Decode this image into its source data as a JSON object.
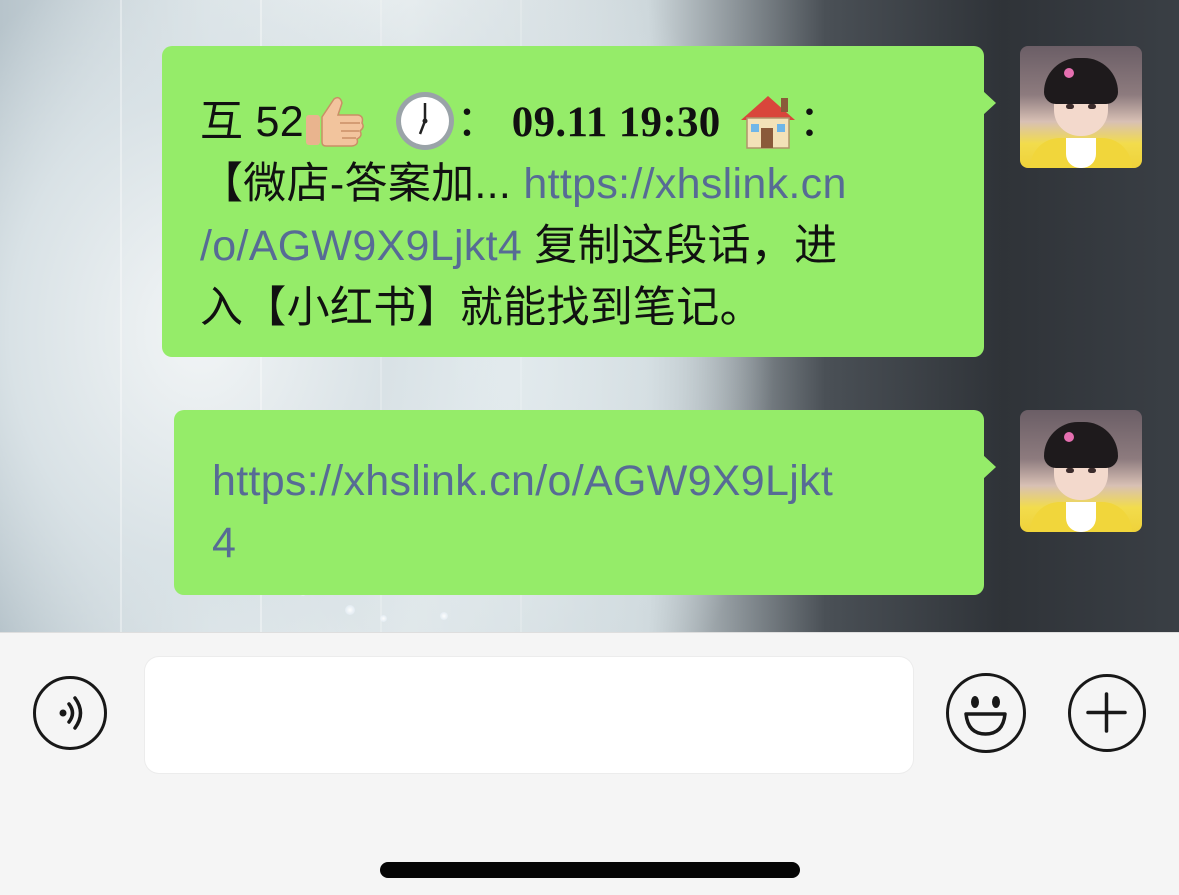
{
  "messages": [
    {
      "line1_prefix": "互 52",
      "line1_sep1": "：",
      "line1_time": "09.11 19:30",
      "line1_sep2": "：",
      "line2_text": "【微店-答案加... ",
      "line2_link": "https://xhslink.cn",
      "line3_link": "/o/AGW9X9Ljkt4",
      "line3_text": " 复制这段话，进",
      "line4_text": "入【小红书】就能找到笔记。",
      "emoji": [
        "thumbs-up",
        "clock",
        "house"
      ]
    },
    {
      "link_line1": "https://xhslink.cn/o/AGW9X9Ljkt",
      "link_line2": "4"
    }
  ],
  "input": {
    "value": "",
    "placeholder": ""
  },
  "icons": {
    "voice": "voice-icon",
    "emoji": "smiley-face-icon",
    "more": "plus-icon"
  },
  "colors": {
    "bubble": "#95ec69",
    "link": "#576b95",
    "input_bar": "#f5f5f5"
  }
}
